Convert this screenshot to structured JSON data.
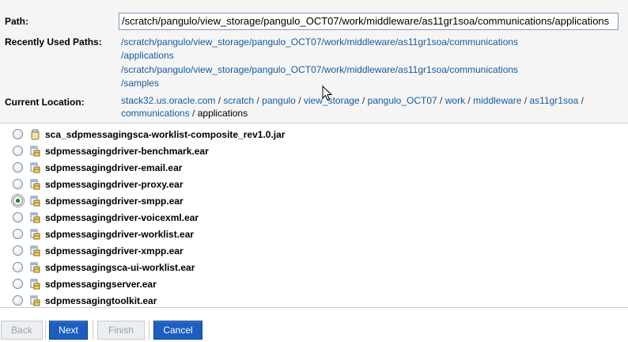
{
  "path": {
    "label": "Path:",
    "value": "/scratch/pangulo/view_storage/pangulo_OCT07/work/middleware/as11gr1soa/communications/applications"
  },
  "recent": {
    "label": "Recently Used Paths:",
    "items": [
      {
        "line1": "/scratch/pangulo/view_storage/pangulo_OCT07/work/middleware/as11gr1soa/communications",
        "line2": "/applications"
      },
      {
        "line1": "/scratch/pangulo/view_storage/pangulo_OCT07/work/middleware/as11gr1soa/communications",
        "line2": "/samples"
      }
    ]
  },
  "location": {
    "label": "Current Location:",
    "crumbs": [
      "stack32.us.oracle.com",
      "scratch",
      "pangulo",
      "view_storage",
      "pangulo_OCT07",
      "work",
      "middleware",
      "as11gr1soa",
      "communications"
    ],
    "current": "applications",
    "separator": "/"
  },
  "files": [
    {
      "name": "sca_sdpmessagingsca-worklist-composite_rev1.0.jar",
      "kind": "jar",
      "selected": false
    },
    {
      "name": "sdpmessagingdriver-benchmark.ear",
      "kind": "ear",
      "selected": false
    },
    {
      "name": "sdpmessagingdriver-email.ear",
      "kind": "ear",
      "selected": false
    },
    {
      "name": "sdpmessagingdriver-proxy.ear",
      "kind": "ear",
      "selected": false
    },
    {
      "name": "sdpmessagingdriver-smpp.ear",
      "kind": "ear",
      "selected": true
    },
    {
      "name": "sdpmessagingdriver-voicexml.ear",
      "kind": "ear",
      "selected": false
    },
    {
      "name": "sdpmessagingdriver-worklist.ear",
      "kind": "ear",
      "selected": false
    },
    {
      "name": "sdpmessagingdriver-xmpp.ear",
      "kind": "ear",
      "selected": false
    },
    {
      "name": "sdpmessagingsca-ui-worklist.ear",
      "kind": "ear",
      "selected": false
    },
    {
      "name": "sdpmessagingserver.ear",
      "kind": "ear",
      "selected": false
    },
    {
      "name": "sdpmessagingtoolkit.ear",
      "kind": "ear",
      "selected": false
    }
  ],
  "buttons": {
    "back": "Back",
    "next": "Next",
    "finish": "Finish",
    "cancel": "Cancel"
  },
  "colors": {
    "link": "#145c9e",
    "primary_button": "#1d5fc0",
    "panel_background": "#f5f5f5"
  }
}
